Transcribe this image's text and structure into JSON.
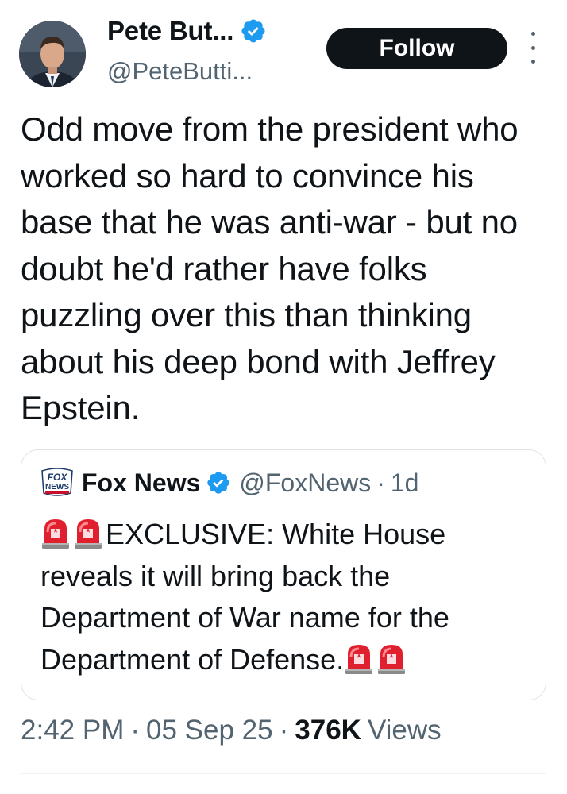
{
  "author": {
    "name": "Pete But...",
    "handle": "@PeteButti...",
    "verified": true
  },
  "follow_label": "Follow",
  "tweet_text": "Odd move from the president who worked so hard to convince his base that he was anti-war - but no doubt he'd rather have folks puzzling over this than thinking about his deep bond with Jeffrey Epstein.",
  "quote": {
    "logo_text": "FOX NEWS channel",
    "name": "Fox News",
    "handle": "@FoxNews",
    "separator": "·",
    "time": "1d",
    "verified": true,
    "text": "EXCLUSIVE: White House reveals it will bring back the Department of War name for the Department of Defense.",
    "leading_icons": [
      "police-light-icon",
      "police-light-icon"
    ],
    "trailing_icons": [
      "police-light-icon",
      "police-light-icon"
    ]
  },
  "meta": {
    "time": "2:42 PM",
    "separator": "·",
    "date": "05 Sep 25",
    "views_count": "376K",
    "views_label": "Views"
  },
  "colors": {
    "text_primary": "#0f1419",
    "text_secondary": "#536471",
    "verified_blue": "#1d9bf0",
    "follow_bg": "#0f1419",
    "border": "#dfe3e7"
  }
}
